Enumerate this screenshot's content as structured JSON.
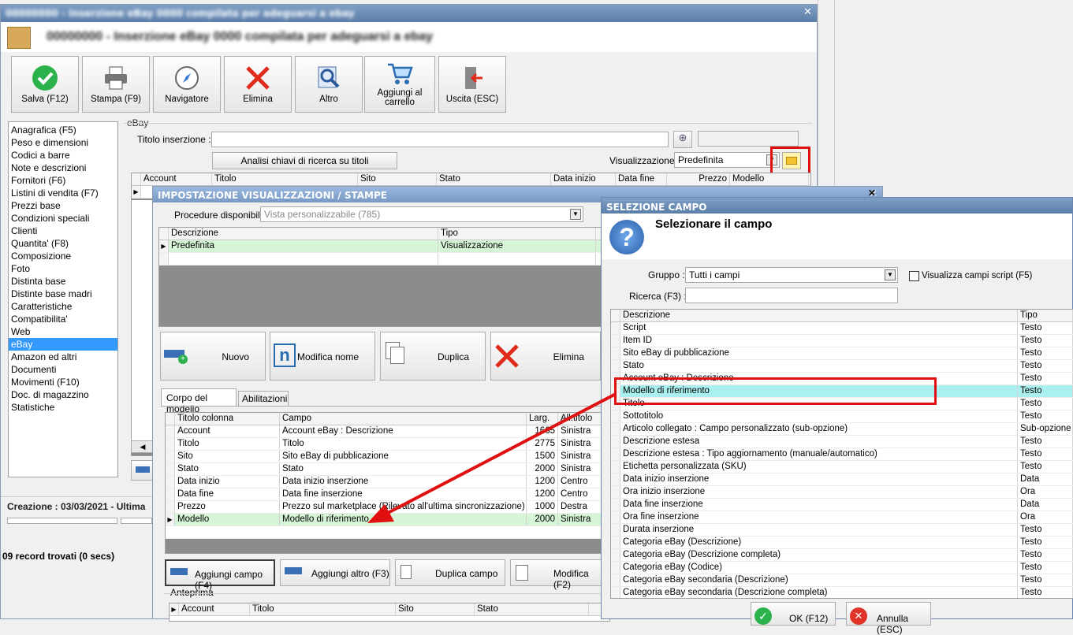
{
  "main": {
    "title_blurred": "00000000 - Inserzione eBay 0000 compilata per adeguarsi a ebay",
    "toolbar": [
      {
        "label": "Salva (F12)",
        "icon": "check-icon"
      },
      {
        "label": "Stampa (F9)",
        "icon": "printer-icon"
      },
      {
        "label": "Navigatore",
        "icon": "compass-icon"
      },
      {
        "label": "Elimina",
        "icon": "delete-x-icon"
      },
      {
        "label": "Altro",
        "icon": "magnifier-icon"
      },
      {
        "label": "Aggiungi al carrello",
        "icon": "cart-icon"
      },
      {
        "label": "Uscita (ESC)",
        "icon": "exit-door-icon"
      }
    ],
    "nav": [
      "Anagrafica (F5)",
      "Peso e dimensioni",
      "Codici a barre",
      "Note e descrizioni",
      "Fornitori (F6)",
      "Listini di vendita (F7)",
      "Prezzi base",
      "Condizioni speciali",
      "Clienti",
      "Quantita' (F8)",
      "Composizione",
      "Foto",
      "Distinta base",
      "Distinte base madri",
      "Caratteristiche",
      "Compatibilita'",
      "Web",
      "eBay",
      "Amazon ed altri",
      "Documenti",
      "Movimenti (F10)",
      "Doc. di magazzino",
      "Statistiche"
    ],
    "nav_selected": "eBay",
    "group_label": "eBay",
    "titolo_label": "Titolo inserzione :",
    "analisi_button": "Analisi chiavi di ricerca su titoli",
    "visualizzazione_label": "Visualizzazione :",
    "visualizzazione_value": "Predefinita",
    "grid_headers": [
      "Account",
      "Titolo",
      "Sito",
      "Stato",
      "Data inizio",
      "Data fine",
      "Prezzo",
      "Modello"
    ],
    "creazione": "Creazione : 03/03/2021 - Ultima",
    "records": "09 record trovati (0 secs)"
  },
  "impostazione": {
    "title": "IMPOSTAZIONE VISUALIZZAZIONI / STAMPE",
    "procedure_label": "Procedure disponibili :",
    "procedure_value": "Vista personalizzabile (785)",
    "list_headers": [
      "Descrizione",
      "Tipo"
    ],
    "list_rows": [
      {
        "descrizione": "Predefinita",
        "tipo": "Visualizzazione"
      }
    ],
    "buttons": [
      "Nuovo",
      "Modifica nome",
      "Duplica",
      "Elimina"
    ],
    "tabs": [
      "Corpo del modello",
      "Abilitazioni"
    ],
    "cols_headers": [
      "Titolo colonna",
      "Campo",
      "Larg.",
      "Allineamento"
    ],
    "cols_headers_visible": [
      "Titolo colonna",
      "Campo",
      "Larg.",
      "All.titolo"
    ],
    "cols_rows": [
      {
        "titolo": "Account",
        "campo": "Account eBay : Descrizione",
        "larg": "1665",
        "all": "Sinistra"
      },
      {
        "titolo": "Titolo",
        "campo": "Titolo",
        "larg": "2775",
        "all": "Sinistra"
      },
      {
        "titolo": "Sito",
        "campo": "Sito eBay di pubblicazione",
        "larg": "1500",
        "all": "Sinistra"
      },
      {
        "titolo": "Stato",
        "campo": "Stato",
        "larg": "2000",
        "all": "Sinistra"
      },
      {
        "titolo": "Data inizio",
        "campo": "Data inizio inserzione",
        "larg": "1200",
        "all": "Centro"
      },
      {
        "titolo": "Data fine",
        "campo": "Data fine inserzione",
        "larg": "1200",
        "all": "Centro"
      },
      {
        "titolo": "Prezzo",
        "campo": "Prezzo sul marketplace (Rilevato all'ultima sincronizzazione)",
        "larg": "1000",
        "all": "Destra"
      },
      {
        "titolo": "Modello",
        "campo": "Modello di riferimento",
        "larg": "2000",
        "all": "Sinistra"
      }
    ],
    "bottom_buttons": [
      "Aggiungi campo (F4)",
      "Aggiungi altro (F3)",
      "Duplica campo",
      "Modifica (F2)"
    ],
    "anteprima_label": "Anteprima",
    "anteprima_headers": [
      "Account",
      "Titolo",
      "Sito",
      "Stato"
    ]
  },
  "selezione": {
    "title": "SELEZIONE CAMPO",
    "heading": "Selezionare il campo",
    "gruppo_label": "Gruppo :",
    "gruppo_value": "Tutti i campi",
    "script_checkbox": "Visualizza campi script (F5)",
    "ricerca_label": "Ricerca (F3) :",
    "ricerca_value": "",
    "headers": [
      "Descrizione",
      "Tipo"
    ],
    "rows": [
      {
        "d": "Script",
        "t": "Testo"
      },
      {
        "d": "Item ID",
        "t": "Testo"
      },
      {
        "d": "Sito eBay di pubblicazione",
        "t": "Testo"
      },
      {
        "d": "Stato",
        "t": "Testo"
      },
      {
        "d": "Account eBay : Descrizione",
        "t": "Testo"
      },
      {
        "d": "Modello di riferimento",
        "t": "Testo"
      },
      {
        "d": "Titolo",
        "t": "Testo"
      },
      {
        "d": "Sottotitolo",
        "t": "Testo"
      },
      {
        "d": "Articolo collegato : Campo personalizzato (sub-opzione)",
        "t": "Sub-opzione"
      },
      {
        "d": "Descrizione estesa",
        "t": "Testo"
      },
      {
        "d": "Descrizione estesa : Tipo aggiornamento (manuale/automatico)",
        "t": "Testo"
      },
      {
        "d": "Etichetta personalizzata (SKU)",
        "t": "Testo"
      },
      {
        "d": "Data inizio inserzione",
        "t": "Data"
      },
      {
        "d": "Ora inizio inserzione",
        "t": "Ora"
      },
      {
        "d": "Data fine inserzione",
        "t": "Data"
      },
      {
        "d": "Ora fine inserzione",
        "t": "Ora"
      },
      {
        "d": "Durata inserzione",
        "t": "Testo"
      },
      {
        "d": "Categoria eBay (Descrizione)",
        "t": "Testo"
      },
      {
        "d": "Categoria eBay (Descrizione completa)",
        "t": "Testo"
      },
      {
        "d": "Categoria eBay (Codice)",
        "t": "Testo"
      },
      {
        "d": "Categoria eBay secondaria (Descrizione)",
        "t": "Testo"
      },
      {
        "d": "Categoria eBay secondaria (Descrizione completa)",
        "t": "Testo"
      }
    ],
    "selected_row": "Modello di riferimento",
    "ok_button": "OK (F12)",
    "annulla_button": "Annulla (ESC)"
  },
  "colors": {
    "titlebar_blue": "#6b8fb8",
    "highlight_red": "#e01010",
    "selection_blue": "#3399ff",
    "row_green": "#d6f5d6",
    "row_cyan": "#aaf0f0"
  }
}
